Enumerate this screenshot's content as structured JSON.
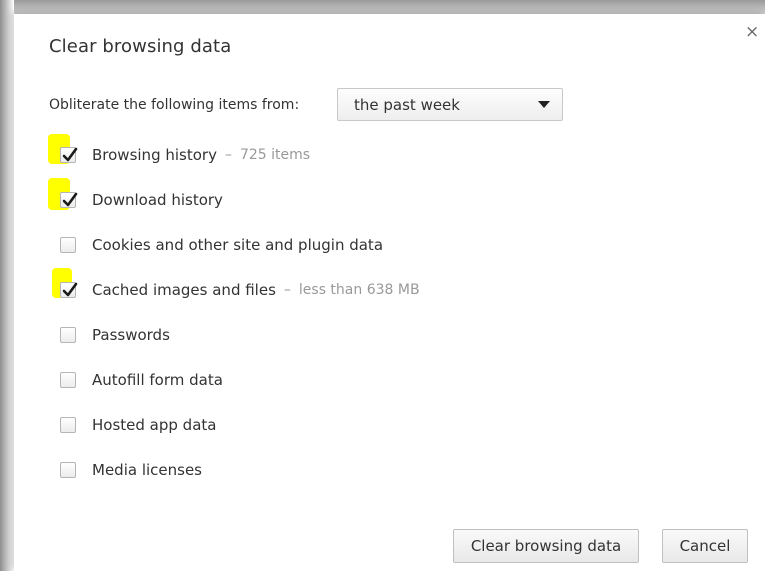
{
  "dialog": {
    "title": "Clear browsing data",
    "close_symbol": "×"
  },
  "range": {
    "label": "Obliterate the following items from:",
    "selected": "the past week"
  },
  "items": [
    {
      "label": "Browsing history",
      "separator": "–",
      "detail": "725 items",
      "checked": true,
      "highlighted": true
    },
    {
      "label": "Download history",
      "separator": "",
      "detail": "",
      "checked": true,
      "highlighted": true
    },
    {
      "label": "Cookies and other site and plugin data",
      "separator": "",
      "detail": "",
      "checked": false,
      "highlighted": false
    },
    {
      "label": "Cached images and files",
      "separator": "–",
      "detail": "less than 638 MB",
      "checked": true,
      "highlighted": true
    },
    {
      "label": "Passwords",
      "separator": "",
      "detail": "",
      "checked": false,
      "highlighted": false
    },
    {
      "label": "Autofill form data",
      "separator": "",
      "detail": "",
      "checked": false,
      "highlighted": false
    },
    {
      "label": "Hosted app data",
      "separator": "",
      "detail": "",
      "checked": false,
      "highlighted": false
    },
    {
      "label": "Media licenses",
      "separator": "",
      "detail": "",
      "checked": false,
      "highlighted": false
    }
  ],
  "buttons": {
    "clear_label": "Clear browsing data",
    "cancel_label": "Cancel"
  },
  "colors": {
    "highlight": "#ffff00",
    "text": "#333333",
    "detail_text": "#999999"
  }
}
